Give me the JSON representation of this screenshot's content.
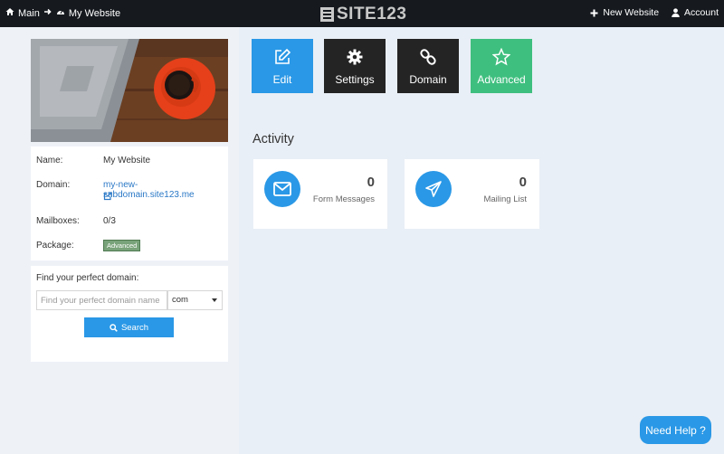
{
  "topbar": {
    "crumb_main": "Main",
    "crumb_site": "My Website",
    "logo": "SITE123",
    "new_website": "New Website",
    "account": "Account"
  },
  "site_info": {
    "name_label": "Name:",
    "name_value": "My Website",
    "domain_label": "Domain:",
    "domain_value": "my-new-subdomain.site123.me",
    "mailboxes_label": "Mailboxes:",
    "mailboxes_value": "0/3",
    "package_label": "Package:",
    "package_value": "Advanced"
  },
  "domain_search": {
    "title": "Find your perfect domain:",
    "placeholder": "Find your perfect domain name",
    "tld_selected": "com",
    "search_label": "Search"
  },
  "actions": {
    "edit": "Edit",
    "settings": "Settings",
    "domain": "Domain",
    "advanced": "Advanced"
  },
  "activity": {
    "title": "Activity",
    "form_messages_count": "0",
    "form_messages_label": "Form Messages",
    "mailing_list_count": "0",
    "mailing_list_label": "Mailing List"
  },
  "help": {
    "label": "Need Help ?"
  },
  "colors": {
    "topbar": "#161a1f",
    "primary_blue": "#2a98e6",
    "dark_tile": "#242424",
    "green_tile": "#3fbf7f"
  }
}
